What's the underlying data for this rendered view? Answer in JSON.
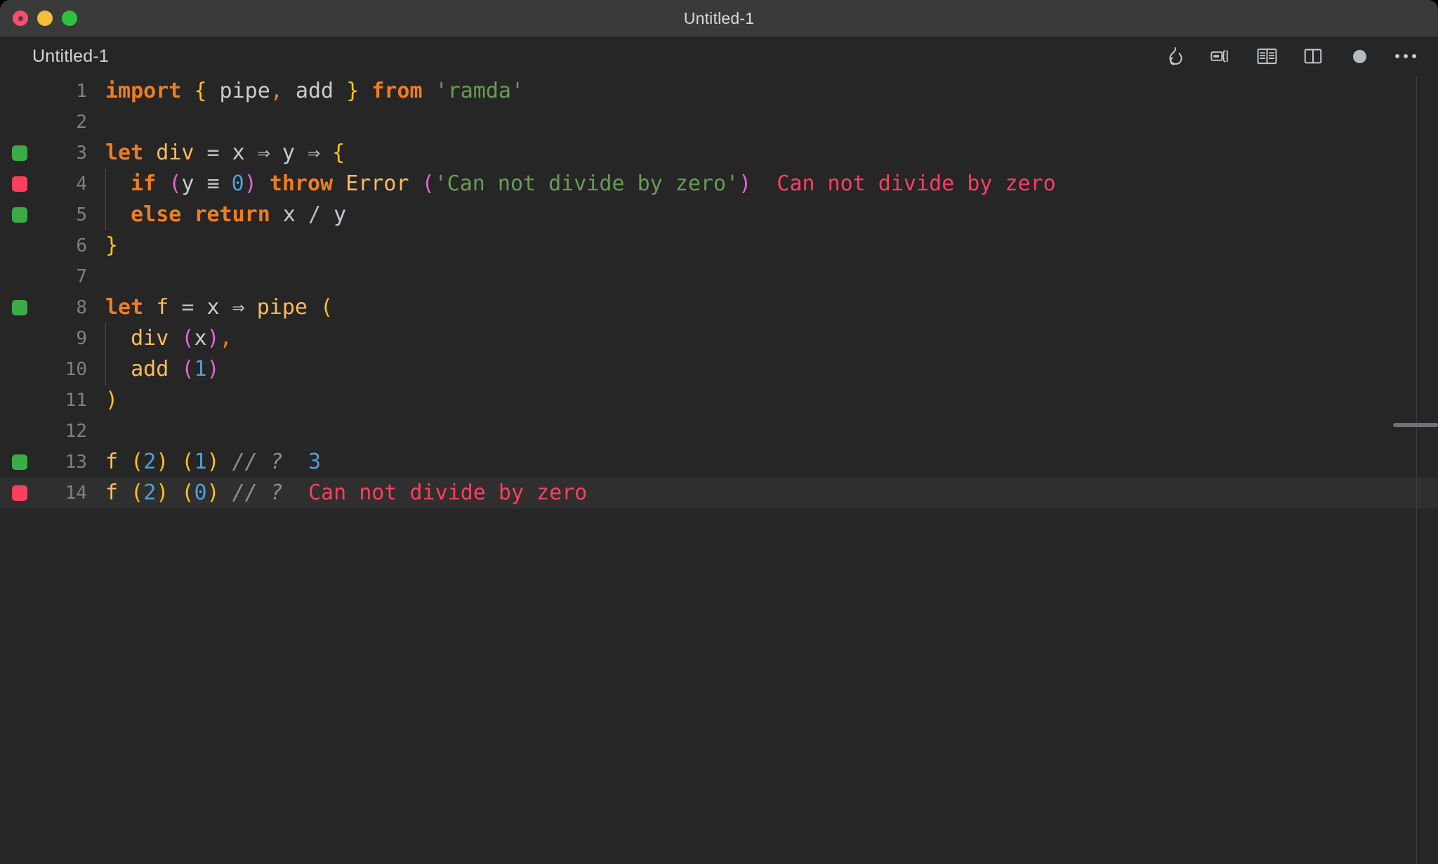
{
  "window": {
    "title": "Untitled-1",
    "traffic_lights": [
      "close",
      "minimize",
      "maximize"
    ]
  },
  "tab": {
    "label": "Untitled-1"
  },
  "toolbar": {
    "items": [
      {
        "name": "quokka-flame-icon",
        "label": "Quokka"
      },
      {
        "name": "run-preview-icon",
        "label": "Open Preview to the Side"
      },
      {
        "name": "book-preview-icon",
        "label": "Open Preview"
      },
      {
        "name": "split-editor-icon",
        "label": "Split Editor"
      },
      {
        "name": "unsaved-dot-icon",
        "label": "Unsaved changes"
      },
      {
        "name": "more-actions-icon",
        "label": "More Actions..."
      }
    ]
  },
  "colors": {
    "background": "#262626",
    "titlebar": "#3a3a3a",
    "current_line": "#2f2f2f",
    "coverage_ok": "#3aab45",
    "coverage_error": "#fc3f5f",
    "keyword": "#ef7d20",
    "function": "#fbbd5c",
    "brace": "#f8c21c",
    "paren": "#e665d8",
    "number": "#4ea0d6",
    "string": "#679c54",
    "comment": "#8b8f93",
    "error_text": "#fc3f5f",
    "linenumber": "#7e8184"
  },
  "editor": {
    "lines": [
      {
        "number": "1",
        "coverage": "none",
        "current": false,
        "guides": 0,
        "tokens": [
          {
            "t": "import",
            "c": "kw"
          },
          {
            "t": " ",
            "c": "plain"
          },
          {
            "t": "{",
            "c": "brc"
          },
          {
            "t": " pipe",
            "c": "var"
          },
          {
            "t": ",",
            "c": "punc"
          },
          {
            "t": " add ",
            "c": "var"
          },
          {
            "t": "}",
            "c": "brc"
          },
          {
            "t": " ",
            "c": "plain"
          },
          {
            "t": "from",
            "c": "kw"
          },
          {
            "t": " ",
            "c": "plain"
          },
          {
            "t": "'ramda'",
            "c": "str"
          }
        ],
        "annotation": null
      },
      {
        "number": "2",
        "coverage": "none",
        "current": false,
        "guides": 0,
        "tokens": [],
        "annotation": null
      },
      {
        "number": "3",
        "coverage": "ok",
        "current": false,
        "guides": 0,
        "tokens": [
          {
            "t": "let",
            "c": "kw"
          },
          {
            "t": " ",
            "c": "plain"
          },
          {
            "t": "div",
            "c": "fn"
          },
          {
            "t": " ",
            "c": "plain"
          },
          {
            "t": "=",
            "c": "op"
          },
          {
            "t": " x ",
            "c": "var"
          },
          {
            "t": "⇒",
            "c": "op"
          },
          {
            "t": " y ",
            "c": "var"
          },
          {
            "t": "⇒",
            "c": "op"
          },
          {
            "t": " ",
            "c": "plain"
          },
          {
            "t": "{",
            "c": "brc"
          }
        ],
        "annotation": null
      },
      {
        "number": "4",
        "coverage": "error",
        "current": false,
        "guides": 1,
        "tokens": [
          {
            "t": "  ",
            "c": "plain"
          },
          {
            "t": "if",
            "c": "kw"
          },
          {
            "t": " ",
            "c": "plain"
          },
          {
            "t": "(",
            "c": "paren"
          },
          {
            "t": "y ",
            "c": "var"
          },
          {
            "t": "≡",
            "c": "op"
          },
          {
            "t": " ",
            "c": "plain"
          },
          {
            "t": "0",
            "c": "num"
          },
          {
            "t": ")",
            "c": "paren"
          },
          {
            "t": " ",
            "c": "plain"
          },
          {
            "t": "throw",
            "c": "kw"
          },
          {
            "t": " ",
            "c": "plain"
          },
          {
            "t": "Error",
            "c": "fn"
          },
          {
            "t": " ",
            "c": "plain"
          },
          {
            "t": "(",
            "c": "paren"
          },
          {
            "t": "'Can not divide by zero'",
            "c": "str"
          },
          {
            "t": ")",
            "c": "paren"
          }
        ],
        "annotation": {
          "text": "Can not divide by zero",
          "kind": "error"
        }
      },
      {
        "number": "5",
        "coverage": "ok",
        "current": false,
        "guides": 1,
        "tokens": [
          {
            "t": "  ",
            "c": "plain"
          },
          {
            "t": "else",
            "c": "kw"
          },
          {
            "t": " ",
            "c": "plain"
          },
          {
            "t": "return",
            "c": "kw"
          },
          {
            "t": " x ",
            "c": "var"
          },
          {
            "t": "/",
            "c": "op"
          },
          {
            "t": " y",
            "c": "var"
          }
        ],
        "annotation": null
      },
      {
        "number": "6",
        "coverage": "none",
        "current": false,
        "guides": 0,
        "tokens": [
          {
            "t": "}",
            "c": "brc"
          }
        ],
        "annotation": null
      },
      {
        "number": "7",
        "coverage": "none",
        "current": false,
        "guides": 0,
        "tokens": [],
        "annotation": null
      },
      {
        "number": "8",
        "coverage": "ok",
        "current": false,
        "guides": 0,
        "tokens": [
          {
            "t": "let",
            "c": "kw"
          },
          {
            "t": " ",
            "c": "plain"
          },
          {
            "t": "f",
            "c": "fn"
          },
          {
            "t": " ",
            "c": "plain"
          },
          {
            "t": "=",
            "c": "op"
          },
          {
            "t": " x ",
            "c": "var"
          },
          {
            "t": "⇒",
            "c": "op"
          },
          {
            "t": " ",
            "c": "plain"
          },
          {
            "t": "pipe",
            "c": "fn"
          },
          {
            "t": " ",
            "c": "plain"
          },
          {
            "t": "(",
            "c": "brc"
          }
        ],
        "annotation": null
      },
      {
        "number": "9",
        "coverage": "none",
        "current": false,
        "guides": 1,
        "tokens": [
          {
            "t": "  ",
            "c": "plain"
          },
          {
            "t": "div",
            "c": "fn"
          },
          {
            "t": " ",
            "c": "plain"
          },
          {
            "t": "(",
            "c": "paren"
          },
          {
            "t": "x",
            "c": "var"
          },
          {
            "t": ")",
            "c": "paren"
          },
          {
            "t": ",",
            "c": "punc"
          }
        ],
        "annotation": null
      },
      {
        "number": "10",
        "coverage": "none",
        "current": false,
        "guides": 1,
        "tokens": [
          {
            "t": "  ",
            "c": "plain"
          },
          {
            "t": "add",
            "c": "fn"
          },
          {
            "t": " ",
            "c": "plain"
          },
          {
            "t": "(",
            "c": "paren"
          },
          {
            "t": "1",
            "c": "num"
          },
          {
            "t": ")",
            "c": "paren"
          }
        ],
        "annotation": null
      },
      {
        "number": "11",
        "coverage": "none",
        "current": false,
        "guides": 0,
        "tokens": [
          {
            "t": ")",
            "c": "brc"
          }
        ],
        "annotation": null
      },
      {
        "number": "12",
        "coverage": "none",
        "current": false,
        "guides": 0,
        "tokens": [],
        "annotation": null
      },
      {
        "number": "13",
        "coverage": "ok",
        "current": false,
        "guides": 0,
        "tokens": [
          {
            "t": "f",
            "c": "fn"
          },
          {
            "t": " ",
            "c": "plain"
          },
          {
            "t": "(",
            "c": "brc"
          },
          {
            "t": "2",
            "c": "num"
          },
          {
            "t": ")",
            "c": "brc"
          },
          {
            "t": " ",
            "c": "plain"
          },
          {
            "t": "(",
            "c": "brc"
          },
          {
            "t": "1",
            "c": "num"
          },
          {
            "t": ")",
            "c": "brc"
          },
          {
            "t": " ",
            "c": "plain"
          },
          {
            "t": "// ?",
            "c": "cmt"
          }
        ],
        "annotation": {
          "text": "3",
          "kind": "ok"
        }
      },
      {
        "number": "14",
        "coverage": "error",
        "current": true,
        "guides": 0,
        "tokens": [
          {
            "t": "f",
            "c": "fn"
          },
          {
            "t": " ",
            "c": "plain"
          },
          {
            "t": "(",
            "c": "brc"
          },
          {
            "t": "2",
            "c": "num"
          },
          {
            "t": ")",
            "c": "brc"
          },
          {
            "t": " ",
            "c": "plain"
          },
          {
            "t": "(",
            "c": "brc"
          },
          {
            "t": "0",
            "c": "num"
          },
          {
            "t": ")",
            "c": "brc"
          },
          {
            "t": " ",
            "c": "plain"
          },
          {
            "t": "// ?",
            "c": "cmt"
          }
        ],
        "annotation": {
          "text": "Can not divide by zero",
          "kind": "error"
        }
      }
    ]
  }
}
